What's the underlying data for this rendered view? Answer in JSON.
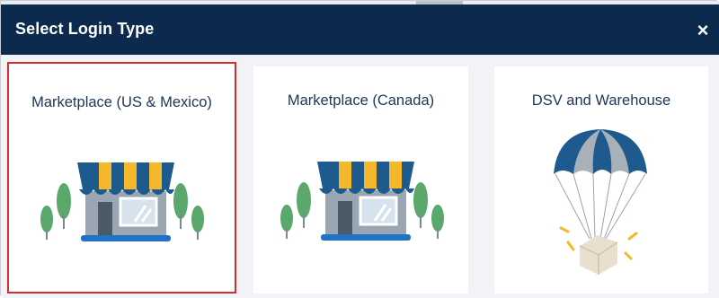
{
  "dialog": {
    "title": "Select Login Type",
    "close_icon": "close-icon",
    "close_glyph": "×"
  },
  "options": [
    {
      "label": "Marketplace (US & Mexico)",
      "illustration": "storefront-icon",
      "selected": true
    },
    {
      "label": "Marketplace (Canada)",
      "illustration": "storefront-icon",
      "selected": false
    },
    {
      "label": "DSV and Warehouse",
      "illustration": "parachute-package-icon",
      "selected": false
    }
  ],
  "colors": {
    "header_bg": "#0b2a4e",
    "selected_border": "#d22e2e",
    "awning_blue": "#1f5a8e",
    "awning_yellow": "#f4b82a",
    "tree_green": "#5aa86b",
    "label_text": "#1d3557"
  }
}
